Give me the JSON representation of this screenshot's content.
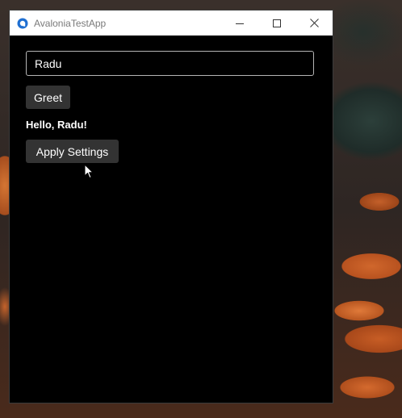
{
  "window": {
    "title": "AvaloniaTestApp",
    "caption_buttons": [
      "minimize",
      "maximize",
      "close"
    ]
  },
  "form": {
    "name_value": "Radu",
    "greet_label": "Greet",
    "greeting_text": "Hello, Radu!",
    "apply_label": "Apply Settings"
  },
  "colors": {
    "window_background": "#000000",
    "button_background": "#333333",
    "titlebar_background": "#ffffff",
    "app_icon": "#1f6fd1"
  },
  "icons": {
    "app": "avalonia-logo-icon",
    "minimize": "minimize-icon",
    "maximize": "maximize-icon",
    "close": "close-icon",
    "cursor": "mouse-pointer-icon"
  }
}
